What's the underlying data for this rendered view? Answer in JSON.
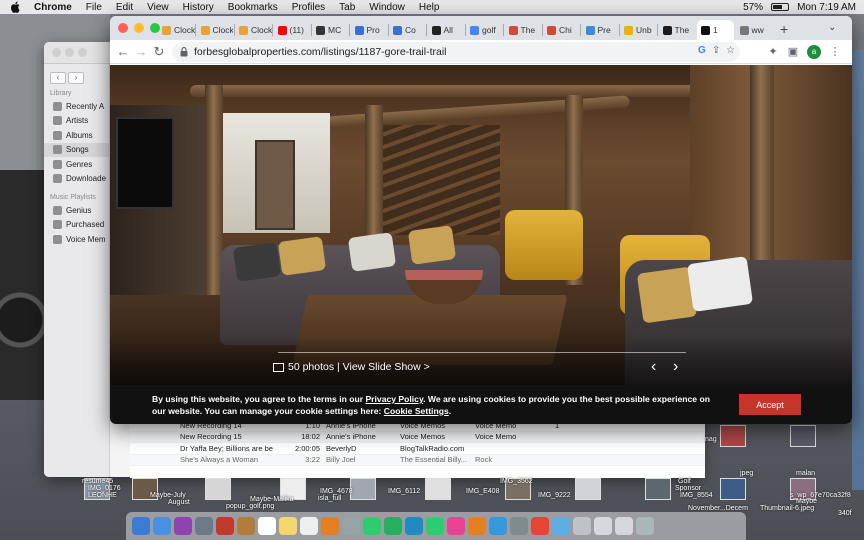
{
  "menubar": {
    "app_name": "Chrome",
    "items": [
      "File",
      "Edit",
      "View",
      "History",
      "Bookmarks",
      "Profiles",
      "Tab",
      "Window",
      "Help"
    ],
    "battery": "57%",
    "clock": "Mon 7:19 AM"
  },
  "browser": {
    "tabs": [
      {
        "label": "Clock e",
        "color": "#e8a23a"
      },
      {
        "label": "Clock e",
        "color": "#e8a23a"
      },
      {
        "label": "Clock e",
        "color": "#e8a23a"
      },
      {
        "label": "(11)",
        "color": "#ff0000"
      },
      {
        "label": "MC",
        "color": "#333333"
      },
      {
        "label": "Pro",
        "color": "#3b6fd1"
      },
      {
        "label": "Co",
        "color": "#3b6fd1"
      },
      {
        "label": "All",
        "color": "#222222"
      },
      {
        "label": "golf",
        "color": "#4285f4"
      },
      {
        "label": "The",
        "color": "#d44836"
      },
      {
        "label": "Chi",
        "color": "#d44836"
      },
      {
        "label": "Pre",
        "color": "#3c8cd8"
      },
      {
        "label": "Unb",
        "color": "#e8b400"
      },
      {
        "label": "The",
        "color": "#1b1b1b"
      },
      {
        "label": "1",
        "color": "#111111"
      },
      {
        "label": "ww",
        "color": "#777777"
      }
    ],
    "url": "forbesglobalproperties.com/listings/1187-gore-trail-trail",
    "profile_initial": "a"
  },
  "listing": {
    "photos_label": "50 photos | View Slide Show >",
    "prev": "‹",
    "next": "›"
  },
  "cookie": {
    "text_1": "By using this website, you agree to the terms in our ",
    "privacy_link": "Privacy Policy",
    "text_2": ". We are using cookies to provide you the best possible experience on our website. You can manage your cookie settings here: ",
    "settings_link": "Cookie Settings",
    "text_3": ".",
    "accept_label": "Accept"
  },
  "music": {
    "library_header": "Library",
    "library_items": [
      "Recently A",
      "Artists",
      "Albums",
      "Songs",
      "Genres",
      "Downloade"
    ],
    "playlists_header": "Music Playlists",
    "playlist_items": [
      "Genius",
      "Purchased",
      "Voice Mem"
    ],
    "tracks": [
      {
        "name": "New Recording 14",
        "time": "1:10",
        "artist": "Annie's iPhone",
        "album": "Voice Memos",
        "genre": "Voice Memo",
        "plays": "1"
      },
      {
        "name": "New Recording 15",
        "time": "18:02",
        "artist": "Annie's iPhone",
        "album": "Voice Memos",
        "genre": "Voice Memo",
        "plays": ""
      },
      {
        "name": "Dr Yaffa Bey;  Billions are be",
        "time": "2:00:05",
        "artist": "BeverlyD",
        "album": "BlogTalkRadio.com",
        "genre": "",
        "plays": ""
      },
      {
        "name": "She's Always a Woman",
        "time": "3:22",
        "artist": "Billy Joel",
        "album": "The Essential Billy...",
        "genre": "Rock",
        "plays": ""
      }
    ]
  },
  "desktop_labels": [
    "resume45",
    "IMG_0176",
    "LEONHE",
    "Maybe-July",
    "August",
    "popup_golf.png",
    "Maybe-Malika",
    "isla_full",
    "IMG_4678",
    "IMG_6112",
    "IMG_E408",
    "IMG_3562",
    "IMG_9222",
    "IMG_8554",
    "nag",
    "jpeg",
    "Golf",
    "Sponsor",
    "November...Decem",
    "Thumbnail-6.jpeg",
    "Maybe",
    "malan",
    "s_wp_67e70ca32f8",
    "340f"
  ]
}
